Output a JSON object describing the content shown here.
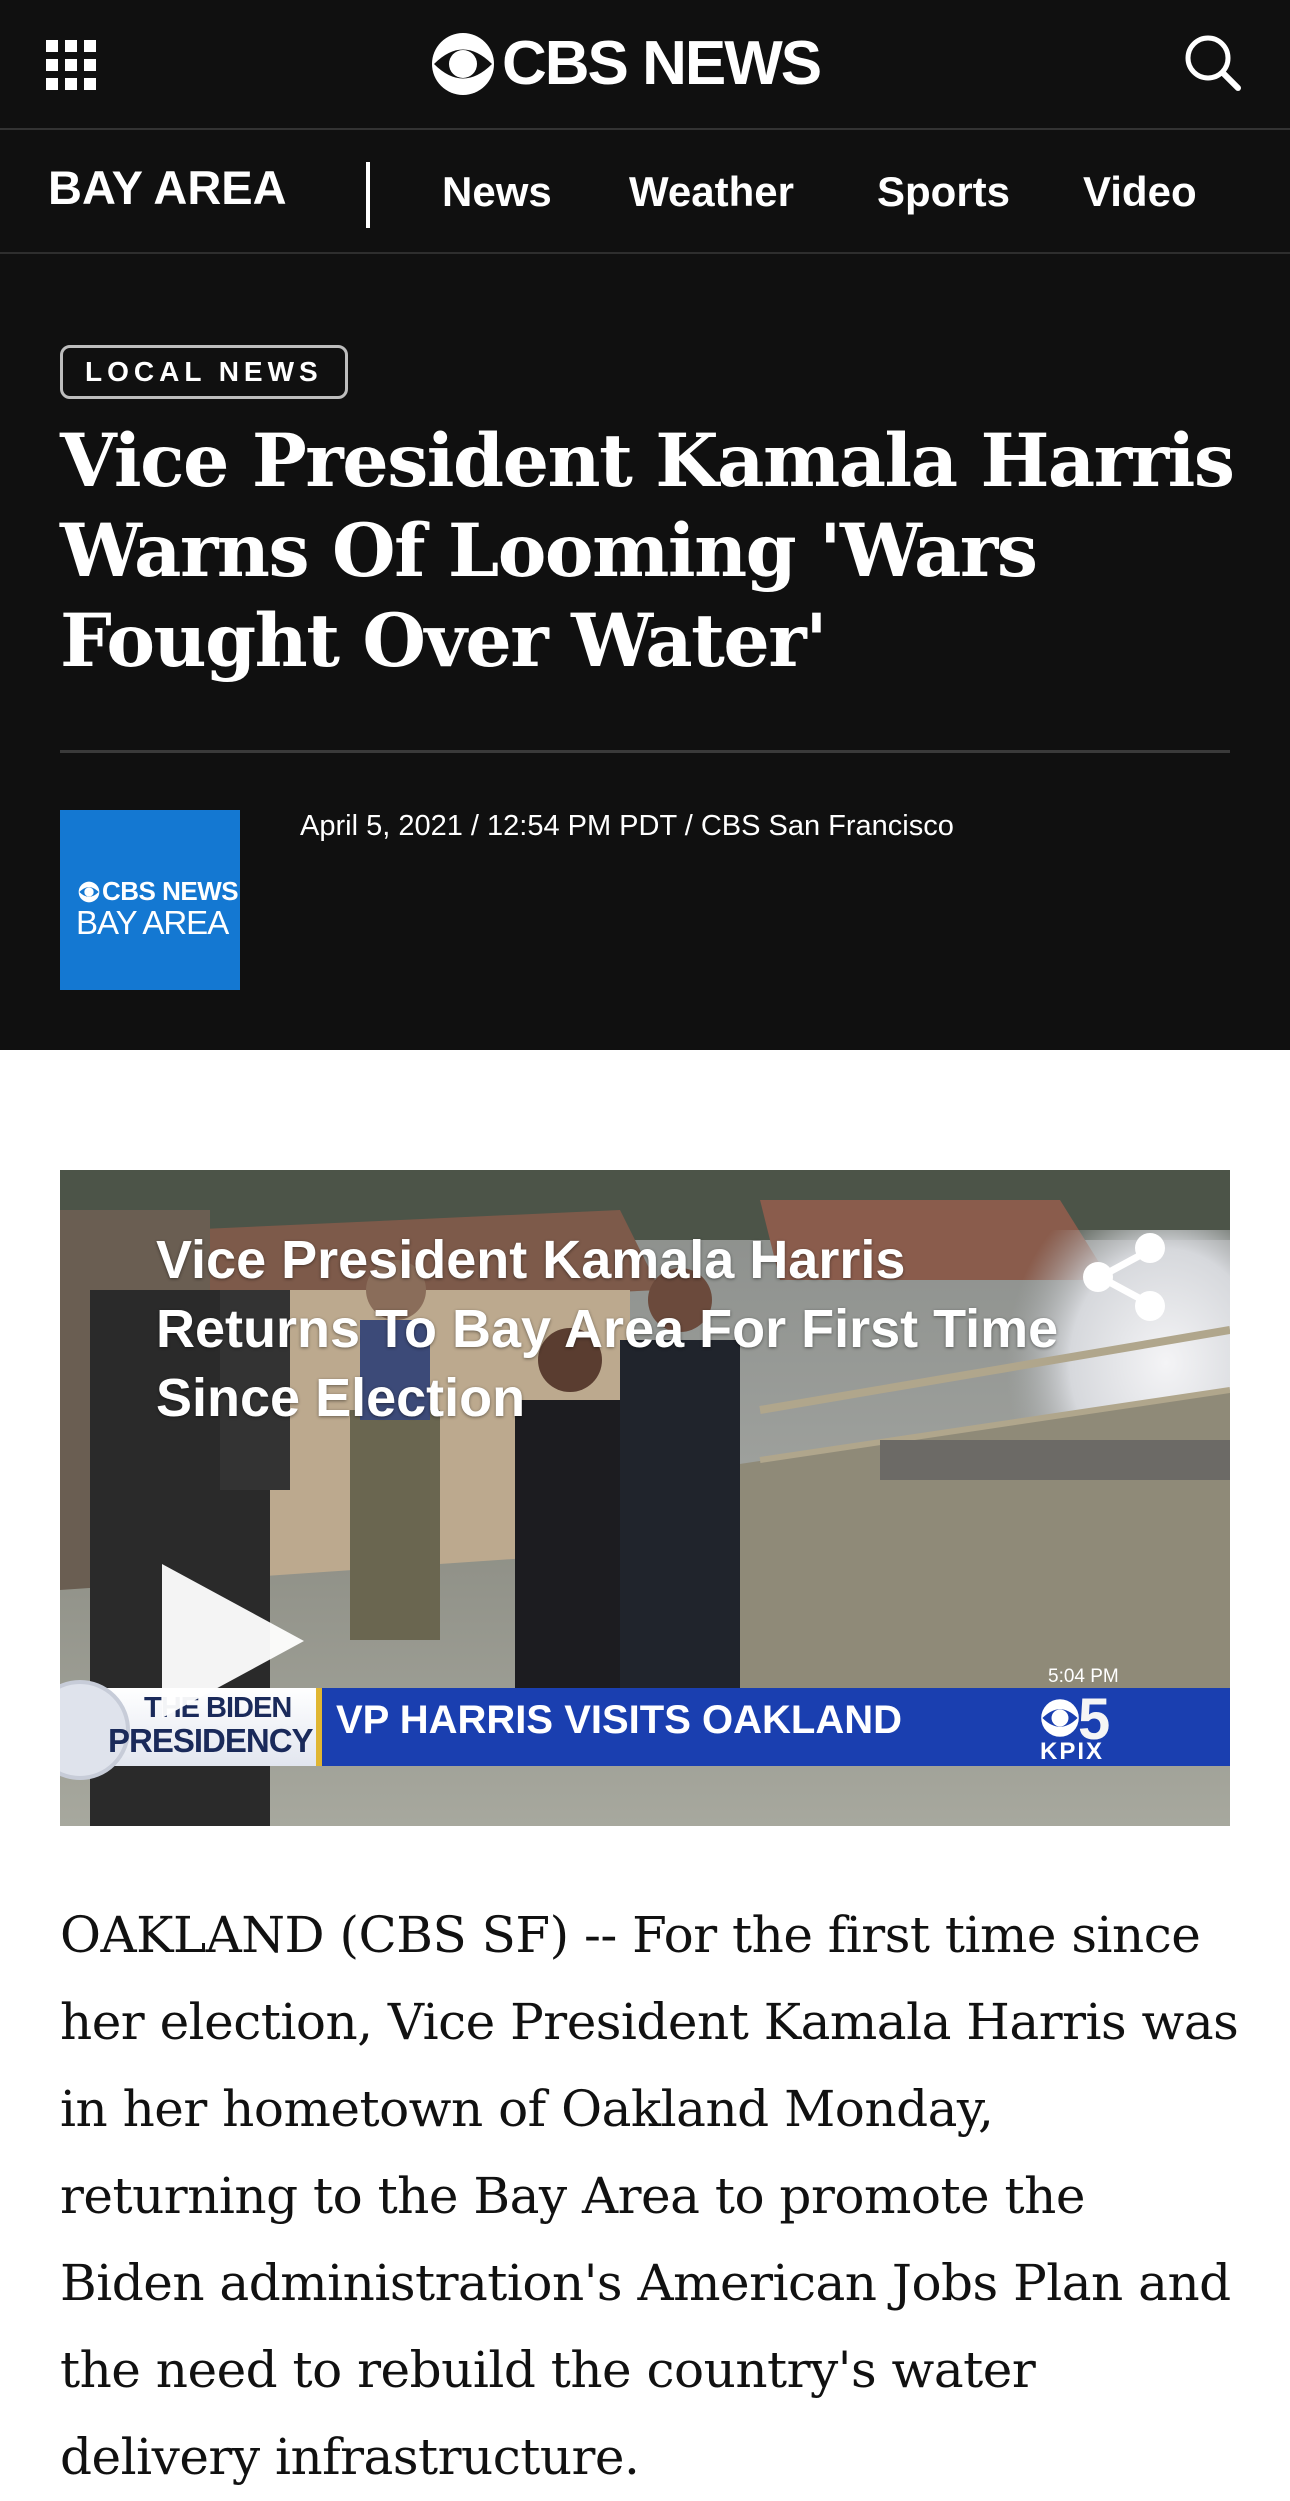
{
  "header": {
    "menu_icon": "grid-menu-icon",
    "logo_text": "CBS NEWS",
    "search_icon": "search-icon"
  },
  "nav": {
    "brand": "BAY AREA",
    "links": [
      "News",
      "Weather",
      "Sports",
      "Video"
    ]
  },
  "article": {
    "category": "LOCAL NEWS",
    "headline": "Vice President Kamala Harris Warns Of Looming 'Wars Fought Over Water'",
    "author_logo": {
      "line1": "CBS NEWS",
      "line2": "BAY AREA"
    },
    "meta": "April 5, 2021 / 12:54 PM PDT / CBS San Francisco",
    "body": "OAKLAND (CBS SF) -- For the first time since her election, Vice President Kamala Harris was in her hometown of Oakland Monday, returning to the Bay Area to promote the Biden administration's American Jobs Plan and the need to rebuild the country's water delivery infrastructure."
  },
  "video": {
    "title": "Vice President Kamala Harris Returns To Bay Area For First Time Since Election",
    "share_icon": "share-icon",
    "play_icon": "play-icon",
    "chyron": {
      "badge_line1": "THE BIDEN",
      "badge_line2": "PRESIDENCY",
      "text": "VP HARRIS VISITS OAKLAND",
      "time": "5:04 PM",
      "station_number": "5",
      "station": "KPIX"
    }
  },
  "colors": {
    "header_bg": "#101010",
    "brand_blue": "#1478d2",
    "chyron_blue": "#1a3fb0"
  }
}
